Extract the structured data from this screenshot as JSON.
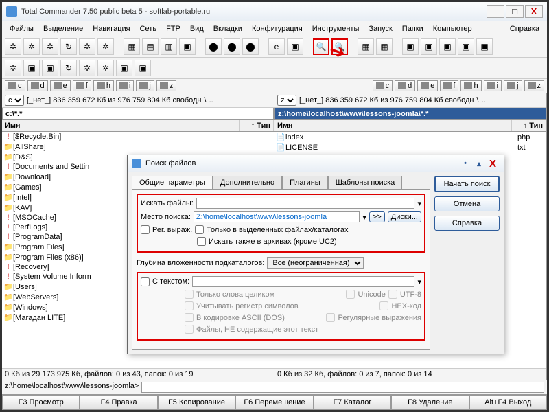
{
  "titlebar": {
    "title": "Total Commander 7.50 public beta 5 - softlab-portable.ru"
  },
  "menu": {
    "items": [
      "Файлы",
      "Выделение",
      "Навигация",
      "Сеть",
      "FTP",
      "Вид",
      "Вкладки",
      "Конфигурация",
      "Инструменты",
      "Запуск",
      "Папки",
      "Компьютер"
    ],
    "help": "Справка"
  },
  "drives": [
    "c",
    "d",
    "e",
    "f",
    "h",
    "i",
    "j",
    "z"
  ],
  "panelLeft": {
    "drive": "c",
    "info": "[_нет_] 836 359 672 Кб из 976 759 804 Кб свободн",
    "path": "c:\\*.*",
    "cols": {
      "name": "Имя",
      "type": "↑ Тип"
    },
    "rows": [
      {
        "i": "!",
        "n": "[$Recycle.Bin]"
      },
      {
        "i": "📁",
        "n": "[AllShare]"
      },
      {
        "i": "📁",
        "n": "[D&S]"
      },
      {
        "i": "!",
        "n": "[Documents and Settin"
      },
      {
        "i": "📁",
        "n": "[Download]"
      },
      {
        "i": "📁",
        "n": "[Games]"
      },
      {
        "i": "📁",
        "n": "[Intel]"
      },
      {
        "i": "📁",
        "n": "[KAV]"
      },
      {
        "i": "!",
        "n": "[MSOCache]"
      },
      {
        "i": "!",
        "n": "[PerfLogs]"
      },
      {
        "i": "!",
        "n": "[ProgramData]"
      },
      {
        "i": "📁",
        "n": "[Program Files]"
      },
      {
        "i": "📁",
        "n": "[Program Files (x86)]"
      },
      {
        "i": "!",
        "n": "[Recovery]"
      },
      {
        "i": "!",
        "n": "[System Volume Inform"
      },
      {
        "i": "📁",
        "n": "[Users]"
      },
      {
        "i": "📁",
        "n": "[WebServers]"
      },
      {
        "i": "📁",
        "n": "[Windows]"
      },
      {
        "i": "📁",
        "n": "[Магадан LITE]"
      }
    ],
    "status": "0 Кб из 29 173 975 Кб, файлов: 0 из 43, папок: 0 из 19"
  },
  "panelRight": {
    "drive": "z",
    "info": "[_нет_] 836 359 672 Кб из 976 759 804 Кб свободн",
    "path": "z:\\home\\localhost\\www\\lessons-joomla\\*.*",
    "cols": {
      "name": "Имя",
      "type": "↑ Тип"
    },
    "rows": [
      {
        "i": "📄",
        "n": "index",
        "e": "php"
      },
      {
        "i": "📄",
        "n": "LICENSE",
        "e": "txt"
      }
    ],
    "status": "0 Кб из 32 Кб, файлов: 0 из 7, папок: 0 из 14"
  },
  "cmdline": {
    "label": "z:\\home\\localhost\\www\\lessons-joomla>"
  },
  "fnkeys": [
    "F3 Просмотр",
    "F4 Правка",
    "F5 Копирование",
    "F6 Перемещение",
    "F7 Каталог",
    "F8 Удаление",
    "Alt+F4 Выход"
  ],
  "dialog": {
    "title": "Поиск файлов",
    "tabs": [
      "Общие параметры",
      "Дополнительно",
      "Плагины",
      "Шаблоны поиска"
    ],
    "lbl_search_files": "Искать файлы:",
    "lbl_search_place": "Место поиска:",
    "search_place_val": "Z:\\home\\localhost\\www\\lessons-joomla",
    "btn_more": ">>",
    "btn_disks": "Диски...",
    "cb_regex": "Рег. выраж.",
    "cb_only_sel": "Только в выделенных файлах/каталогах",
    "cb_arch": "Искать также в архивах (кроме UC2)",
    "lbl_depth": "Глубина вложенности подкаталогов:",
    "depth_val": "Все (неограниченная)",
    "cb_text": "С текстом:",
    "cb_words": "Только слова целиком",
    "cb_case": "Учитывать регистр символов",
    "cb_ascii": "В кодировке ASCII (DOS)",
    "cb_not": "Файлы, НЕ содержащие этот текст",
    "cb_unicode": "Unicode",
    "cb_hex": "HEX-код",
    "cb_utf8": "UTF-8",
    "cb_reexpr": "Регулярные выражения",
    "btn_start": "Начать поиск",
    "btn_cancel": "Отмена",
    "btn_help": "Справка"
  }
}
